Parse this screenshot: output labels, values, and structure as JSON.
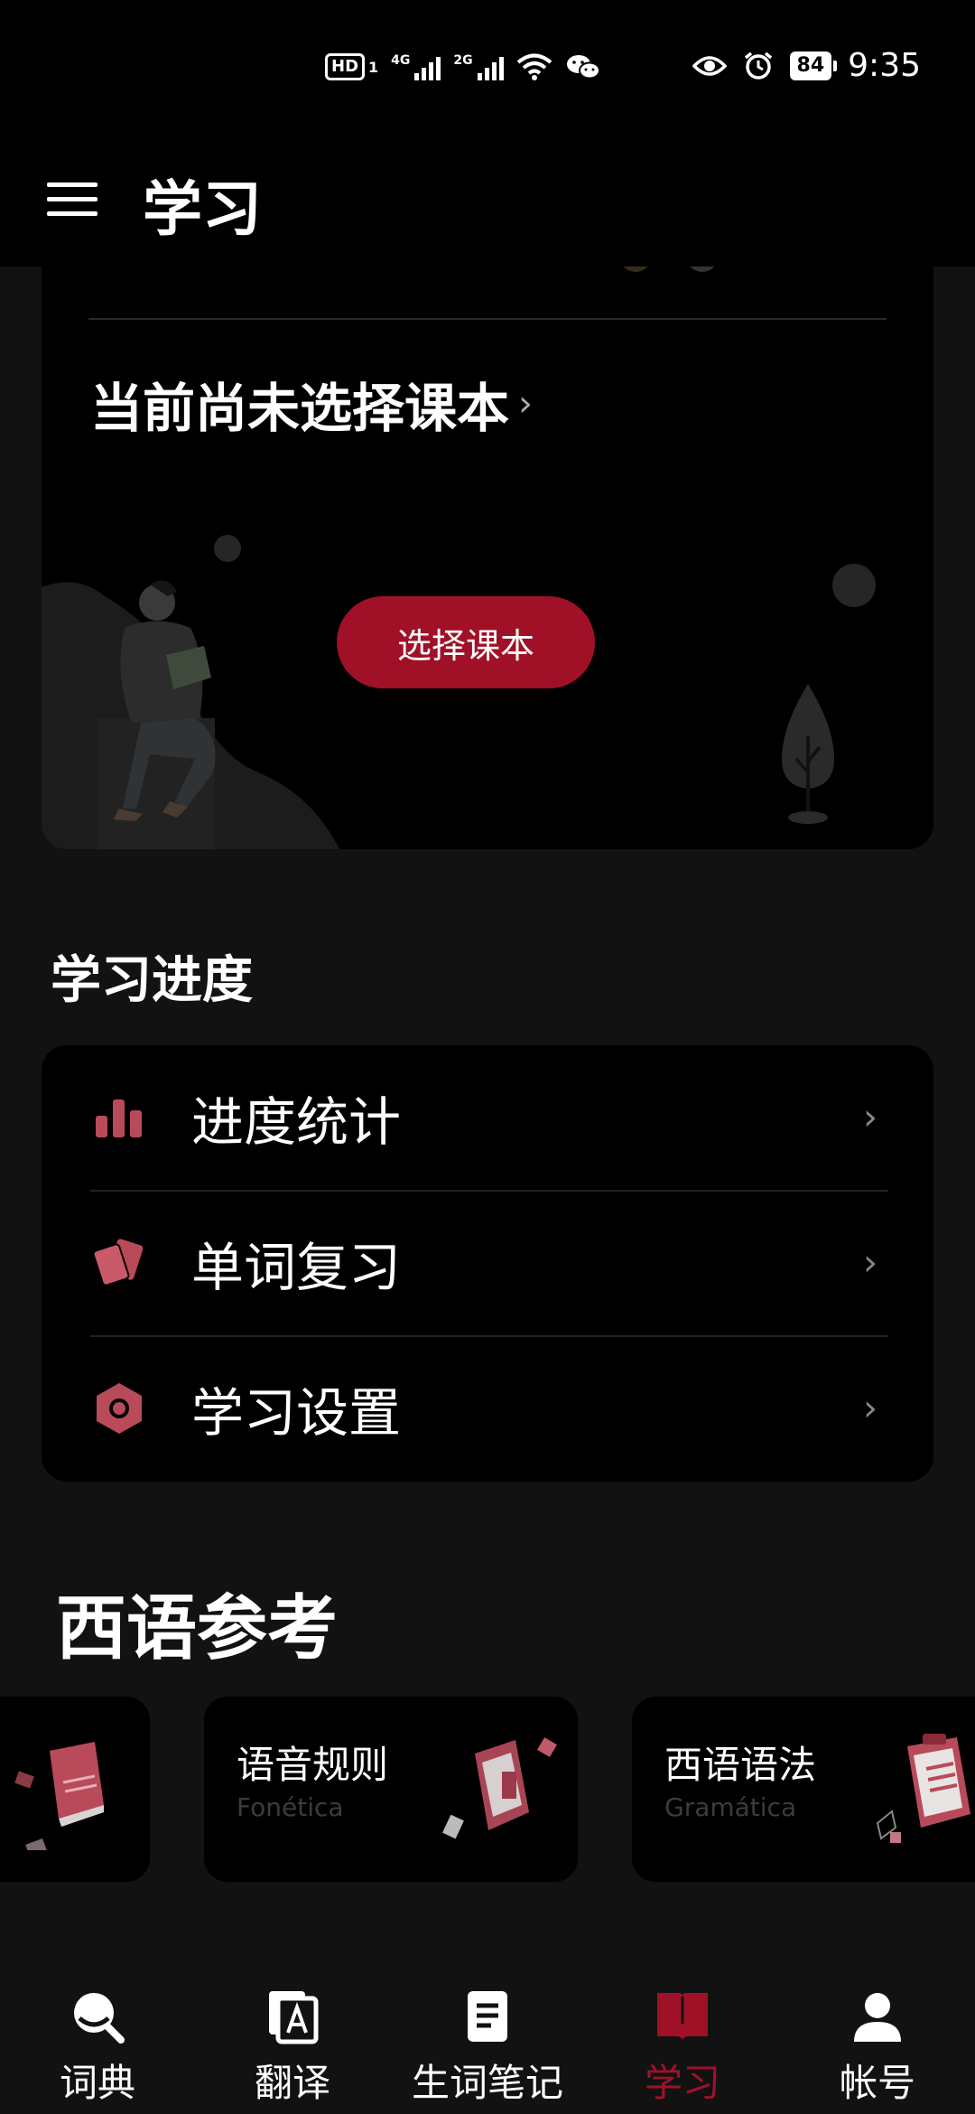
{
  "status_bar": {
    "hd": "HD",
    "sim1": "1",
    "net1": "4G",
    "net2": "2G",
    "battery": "84",
    "time": "9:35"
  },
  "app_bar": {
    "title": "学习"
  },
  "textbook": {
    "title": "当前尚未选择课本",
    "chevron": "›",
    "button": "选择课本"
  },
  "progress": {
    "section_title": "学习进度",
    "items": [
      {
        "label": "进度统计",
        "icon": "bar-chart-icon",
        "chevron": "›"
      },
      {
        "label": "单词复习",
        "icon": "flashcards-icon",
        "chevron": "›"
      },
      {
        "label": "学习设置",
        "icon": "hexagon-settings-icon",
        "chevron": "›"
      }
    ]
  },
  "reference": {
    "section_title": "西语参考",
    "cards": [
      {
        "title": "",
        "subtitle": "",
        "icon": "dictionary-book-icon"
      },
      {
        "title": "语音规则",
        "subtitle": "Fonética",
        "icon": "phonetics-book-icon"
      },
      {
        "title": "西语语法",
        "subtitle": "Gramática",
        "icon": "grammar-clipboard-icon"
      }
    ]
  },
  "bottom_nav": {
    "items": [
      {
        "label": "词典",
        "icon": "search-icon",
        "active": false
      },
      {
        "label": "翻译",
        "icon": "translate-icon",
        "active": false
      },
      {
        "label": "生词笔记",
        "icon": "notes-icon",
        "active": false
      },
      {
        "label": "学习",
        "icon": "book-icon",
        "active": true
      },
      {
        "label": "帐号",
        "icon": "account-icon",
        "active": false
      }
    ]
  },
  "colors": {
    "accent": "#a01128",
    "background": "#121212",
    "card": "#000000"
  }
}
